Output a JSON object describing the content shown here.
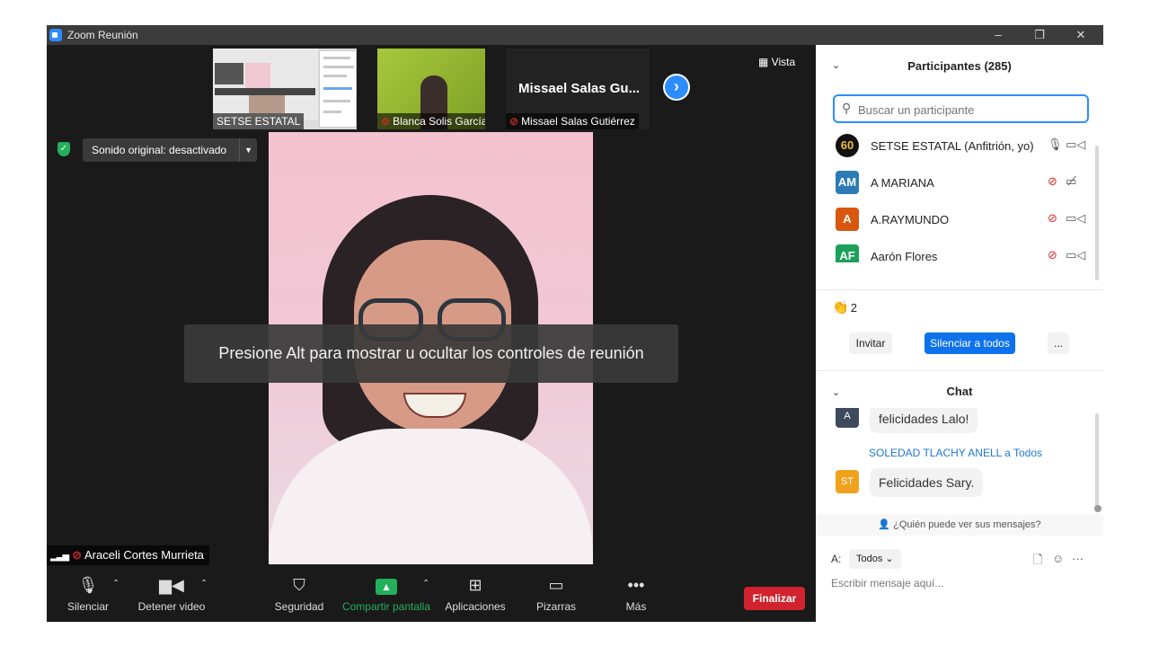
{
  "window": {
    "title": "Zoom Reunión",
    "minimize": "–",
    "restore": "❐",
    "close": "✕"
  },
  "thumbnails": [
    {
      "name": "SETSE ESTATAL",
      "muted": false
    },
    {
      "name": "Blanca Solis García",
      "muted": true
    },
    {
      "name": "Missael Salas Gutiérrez",
      "muted": true,
      "display_name": "Missael Salas Gu..."
    }
  ],
  "view_button": "Vista",
  "sound": {
    "label": "Sonido original: desactivado"
  },
  "hint": "Presione Alt para mostrar u ocultar los controles de reunión",
  "speaker": {
    "name": "Araceli Cortes Murrieta"
  },
  "toolbar": {
    "mute": "Silenciar",
    "video": "Detener video",
    "security": "Seguridad",
    "share": "Compartir pantalla",
    "apps": "Aplicaciones",
    "whiteboards": "Pizarras",
    "more": "Más",
    "end": "Finalizar"
  },
  "participants": {
    "title": "Participantes (285)",
    "search_placeholder": "Buscar un participante",
    "list": [
      {
        "initials": "60",
        "name": "SETSE ESTATAL (Anfitrión, yo)",
        "color": "#111111",
        "muted": false,
        "video_off": false
      },
      {
        "initials": "AM",
        "name": "A MARIANA",
        "color": "#2c7bb6",
        "muted": true,
        "video_off": true
      },
      {
        "initials": "A",
        "name": "A.RAYMUNDO",
        "color": "#d9560f",
        "muted": true,
        "video_off": false
      },
      {
        "initials": "AF",
        "name": "Aarón Flores",
        "color": "#1ba05a",
        "muted": true,
        "video_off": false
      }
    ],
    "reaction_count": "2",
    "invite": "Invitar",
    "mute_all": "Silenciar a todos",
    "more": "..."
  },
  "chat": {
    "title": "Chat",
    "messages": [
      {
        "initials": "A",
        "color": "#3d4a5c",
        "sender": "",
        "text": "felicidades Lalo!"
      },
      {
        "initials": "ST",
        "color": "#f0a21c",
        "sender": "SOLEDAD TLACHY ANELL a Todos",
        "text": "Felicidades Sary."
      }
    ],
    "who_can_see": "¿Quién puede ver sus mensajes?",
    "to_label": "A:",
    "to_value": "Todos",
    "placeholder": "Escribir mensaje aquí..."
  }
}
